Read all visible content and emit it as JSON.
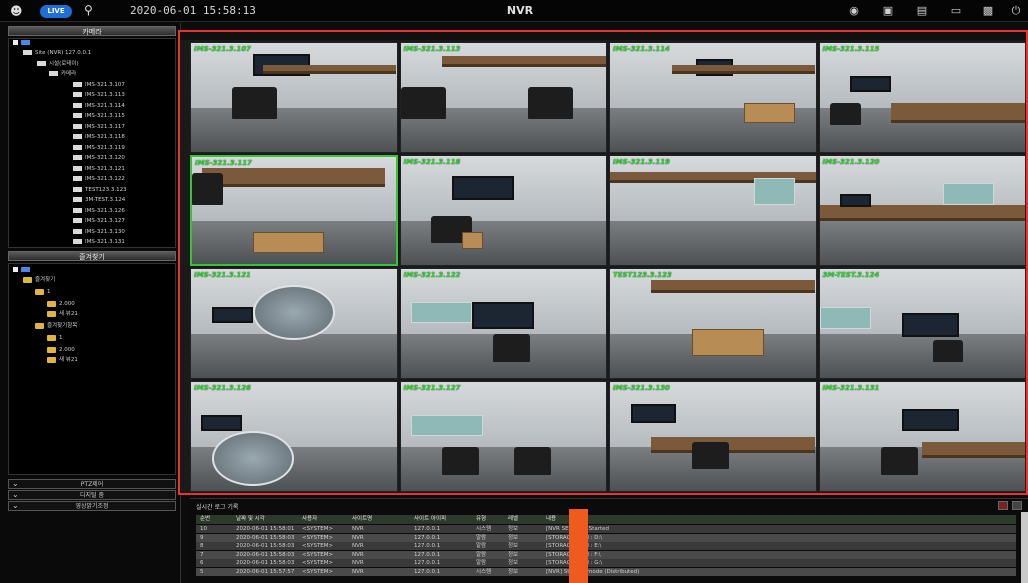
{
  "topbar": {
    "live_label": "LIVE",
    "clock": "2020-06-01 15:58:13",
    "title": "NVR",
    "icons": [
      "user-icon",
      "search-icon",
      "shield-icon",
      "zoom-icon",
      "display-icon",
      "screen-icon",
      "chat-icon",
      "power-icon"
    ]
  },
  "left": {
    "section1_title": "카메라",
    "device_tree": [
      "Site (NVR) 127.0.0.1",
      "시설(로테이)",
      "카메라",
      "IMS-321.3.107",
      "IMS-321.3.113",
      "IMS-321.3.114",
      "IMS-321.3.115",
      "IMS-321.3.117",
      "IMS-321.3.118",
      "IMS-321.3.119",
      "IMS-321.3.120",
      "IMS-321.3.121",
      "IMS-321.3.122",
      "TEST123.3.123",
      "3M-TEST.3.124",
      "IMS-321.3.126",
      "IMS-321.3.127",
      "IMS-321.3.130",
      "IMS-321.3.131"
    ],
    "section2_title": "즐겨찾기",
    "fav_tree": [
      "즐겨찾기",
      "1",
      "2.000",
      "새 뷰21",
      "즐겨찾기항목",
      "1",
      "2.000",
      "새 뷰21"
    ],
    "collapsed_sections": [
      "PTZ제어",
      "디지털 줌",
      "영상밝기조정"
    ]
  },
  "cameras": [
    {
      "label": "IMS-321.3.107"
    },
    {
      "label": "IMS-321.3.113"
    },
    {
      "label": "IMS-321.3.114"
    },
    {
      "label": "IMS-321.3.115"
    },
    {
      "label": "IMS-321.3.117"
    },
    {
      "label": "IMS-321.3.118"
    },
    {
      "label": "IMS-321.3.119"
    },
    {
      "label": "IMS-321.3.120"
    },
    {
      "label": "IMS-321.3.121"
    },
    {
      "label": "IMS-321.3.122"
    },
    {
      "label": "TEST123.3.123"
    },
    {
      "label": "3M-TEST.3.124"
    },
    {
      "label": "IMS-321.3.126"
    },
    {
      "label": "IMS-321.3.127"
    },
    {
      "label": "IMS-321.3.130"
    },
    {
      "label": "IMS-321.3.131"
    }
  ],
  "log": {
    "title": "실시간 로그 기록",
    "columns": [
      "순번",
      "날짜 및 시각",
      "사용자",
      "사이트명",
      "사이트 아이피",
      "유형",
      "레벨",
      "내용"
    ],
    "rows": [
      [
        "10",
        "2020-06-01 15:58:01",
        "<SYSTEM>",
        "NVR",
        "127.0.0.1",
        "시스템",
        "정보",
        "[NVR SERVICE] Started"
      ],
      [
        "9",
        "2020-06-01 15:58:03",
        "<SYSTEM>",
        "NVR",
        "127.0.0.1",
        "알람",
        "정보",
        "[STORAGE] Add : D:\\"
      ],
      [
        "8",
        "2020-06-01 15:58:03",
        "<SYSTEM>",
        "NVR",
        "127.0.0.1",
        "알람",
        "정보",
        "[STORAGE] Add : E:\\"
      ],
      [
        "7",
        "2020-06-01 15:58:03",
        "<SYSTEM>",
        "NVR",
        "127.0.0.1",
        "알람",
        "정보",
        "[STORAGE] Add : F:\\"
      ],
      [
        "6",
        "2020-06-01 15:58:03",
        "<SYSTEM>",
        "NVR",
        "127.0.0.1",
        "알람",
        "정보",
        "[STORAGE] Add : G:\\"
      ],
      [
        "5",
        "2020-06-01 15:57:57",
        "<SYSTEM>",
        "NVR",
        "127.0.0.1",
        "시스템",
        "정보",
        "[NVR] Storage mode (Distributed)"
      ]
    ]
  }
}
